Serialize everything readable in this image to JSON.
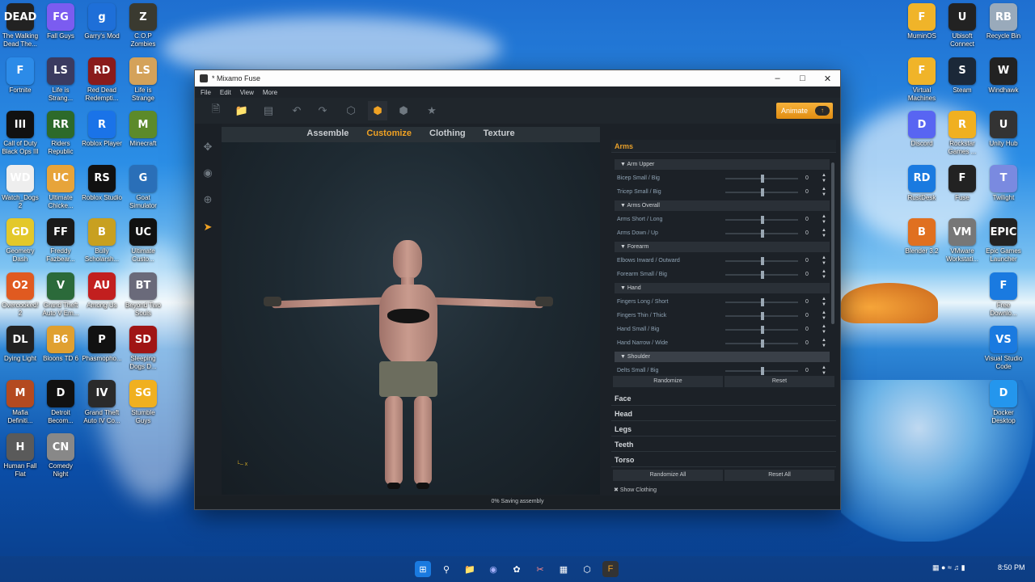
{
  "desktop_left": [
    {
      "label": "The Walking Dead The...",
      "icon": "DEAD",
      "color": "#222"
    },
    {
      "label": "Fall Guys",
      "icon": "FG",
      "color": "#7b5cf0"
    },
    {
      "label": "Garry's Mod",
      "icon": "g",
      "color": "#1e6fd8"
    },
    {
      "label": "C.O.P Zombies",
      "icon": "Z",
      "color": "#3a3a30"
    },
    {
      "label": "Fortnite",
      "icon": "F",
      "color": "#2c8be8"
    },
    {
      "label": "Life is Strang...",
      "icon": "LS",
      "color": "#3b3b60"
    },
    {
      "label": "Red Dead Redempti...",
      "icon": "RD",
      "color": "#8a1b1b"
    },
    {
      "label": "Life is Strange",
      "icon": "LS",
      "color": "#d4a25a"
    },
    {
      "label": "Call of Duty Black Ops III",
      "icon": "III",
      "color": "#111"
    },
    {
      "label": "Riders Republic",
      "icon": "RR",
      "color": "#2d6a2a"
    },
    {
      "label": "Roblox Player",
      "icon": "R",
      "color": "#1a73e8"
    },
    {
      "label": "Minecraft",
      "icon": "M",
      "color": "#5c8a2a"
    },
    {
      "label": "Watch_Dogs 2",
      "icon": "WD",
      "color": "#eee"
    },
    {
      "label": "Ultimate Chicke...",
      "icon": "UC",
      "color": "#e7a43a"
    },
    {
      "label": "Roblox Studio",
      "icon": "RS",
      "color": "#111"
    },
    {
      "label": "Goat Simulator",
      "icon": "G",
      "color": "#2a6fb8"
    },
    {
      "label": "Geometry Dash",
      "icon": "GD",
      "color": "#e3c82a"
    },
    {
      "label": "Freddy Fazbear...",
      "icon": "FF",
      "color": "#1a1a1a"
    },
    {
      "label": "Bully Scholarsh...",
      "icon": "B",
      "color": "#c8a020"
    },
    {
      "label": "Ultimate Custo...",
      "icon": "UC",
      "color": "#111"
    },
    {
      "label": "Overcooked! 2",
      "icon": "O2",
      "color": "#e05a20"
    },
    {
      "label": "Grand Theft Auto V Em...",
      "icon": "V",
      "color": "#2b6a3a"
    },
    {
      "label": "Among Us",
      "icon": "AU",
      "color": "#c21f1f"
    },
    {
      "label": "Beyond Two Souls",
      "icon": "BT",
      "color": "#6a6a7a"
    },
    {
      "label": "Dying Light",
      "icon": "DL",
      "color": "#222"
    },
    {
      "label": "Bloons TD 6",
      "icon": "B6",
      "color": "#e0a030"
    },
    {
      "label": "Phasmopho...",
      "icon": "P",
      "color": "#111"
    },
    {
      "label": "Sleeping Dogs D...",
      "icon": "SD",
      "color": "#a01515"
    },
    {
      "label": "Mafia Definiti...",
      "icon": "M",
      "color": "#b44a20"
    },
    {
      "label": "Detroit Becom...",
      "icon": "D",
      "color": "#111"
    },
    {
      "label": "Grand Theft Auto IV Co...",
      "icon": "IV",
      "color": "#2a2a2a"
    },
    {
      "label": "Stumble Guys",
      "icon": "SG",
      "color": "#f0b020"
    },
    {
      "label": "Human Fall Flat",
      "icon": "H",
      "color": "#5a5a5a"
    },
    {
      "label": "Comedy Night",
      "icon": "CN",
      "color": "#888"
    }
  ],
  "desktop_right": [
    {
      "label": "MuminOS",
      "icon": "F",
      "color": "#f0b429"
    },
    {
      "label": "Ubisoft Connect",
      "icon": "U",
      "color": "#222"
    },
    {
      "label": "Recycle Bin",
      "icon": "RB",
      "color": "#9ab"
    },
    {
      "label": "Virtual Machines",
      "icon": "F",
      "color": "#f0b429"
    },
    {
      "label": "Steam",
      "icon": "S",
      "color": "#1b2838"
    },
    {
      "label": "Windhawk",
      "icon": "W",
      "color": "#222"
    },
    {
      "label": "Discord",
      "icon": "D",
      "color": "#5865f2"
    },
    {
      "label": "Rockstar Games ...",
      "icon": "R",
      "color": "#f0b020"
    },
    {
      "label": "Unity Hub",
      "icon": "U",
      "color": "#333"
    },
    {
      "label": "RustDesk",
      "icon": "RD",
      "color": "#1a7ae0"
    },
    {
      "label": "Fuse",
      "icon": "F",
      "color": "#222"
    },
    {
      "label": "Twilight",
      "icon": "T",
      "color": "#7a8ae0"
    },
    {
      "label": "Blender 3.2",
      "icon": "B",
      "color": "#e07020"
    },
    {
      "label": "VMware Workstati...",
      "icon": "VM",
      "color": "#777"
    },
    {
      "label": "Epic Games Launcher",
      "icon": "EPIC",
      "color": "#222"
    },
    {
      "label": "Free Downlo...",
      "icon": "F",
      "color": "#1a7ae0"
    },
    {
      "label": "Visual Studio Code",
      "icon": "VS",
      "color": "#1a7ae0"
    },
    {
      "label": "Docker Desktop",
      "icon": "D",
      "color": "#2496ed"
    }
  ],
  "window": {
    "title": "* Mixamo Fuse",
    "menu": [
      "File",
      "Edit",
      "View",
      "More"
    ],
    "animate_label": "Animate",
    "tabs": [
      "Assemble",
      "Customize",
      "Clothing",
      "Texture"
    ],
    "active_tab": "Customize",
    "status_text": "0%  Saving assembly",
    "show_clothing": "Show Clothing"
  },
  "panel": {
    "section_title": "Arms",
    "groups": [
      {
        "title": "Arm Upper",
        "rows": [
          {
            "label": "Bicep Small / Big",
            "value": "0"
          },
          {
            "label": "Tricep Small / Big",
            "value": "0"
          }
        ]
      },
      {
        "title": "Arms Overall",
        "rows": [
          {
            "label": "Arms Short / Long",
            "value": "0"
          },
          {
            "label": "Arms Down / Up",
            "value": "0"
          }
        ]
      },
      {
        "title": "Forearm",
        "rows": [
          {
            "label": "Elbows Inward / Outward",
            "value": "0"
          },
          {
            "label": "Forearm Small / Big",
            "value": "0"
          }
        ]
      },
      {
        "title": "Hand",
        "rows": [
          {
            "label": "Fingers Long / Short",
            "value": "0"
          },
          {
            "label": "Fingers Thin / Thick",
            "value": "0"
          },
          {
            "label": "Hand Small / Big",
            "value": "0"
          },
          {
            "label": "Hand Narrow / Wide",
            "value": "0"
          }
        ]
      },
      {
        "title": "Shoulder",
        "rows": [
          {
            "label": "Delts Small / Big",
            "value": "0"
          }
        ]
      }
    ],
    "randomize": "Randomize",
    "reset": "Reset",
    "categories": [
      "Face",
      "Head",
      "Legs",
      "Teeth",
      "Torso"
    ],
    "randomize_all": "Randomize All",
    "reset_all": "Reset All"
  },
  "taskbar": {
    "time": "8:50 PM"
  }
}
